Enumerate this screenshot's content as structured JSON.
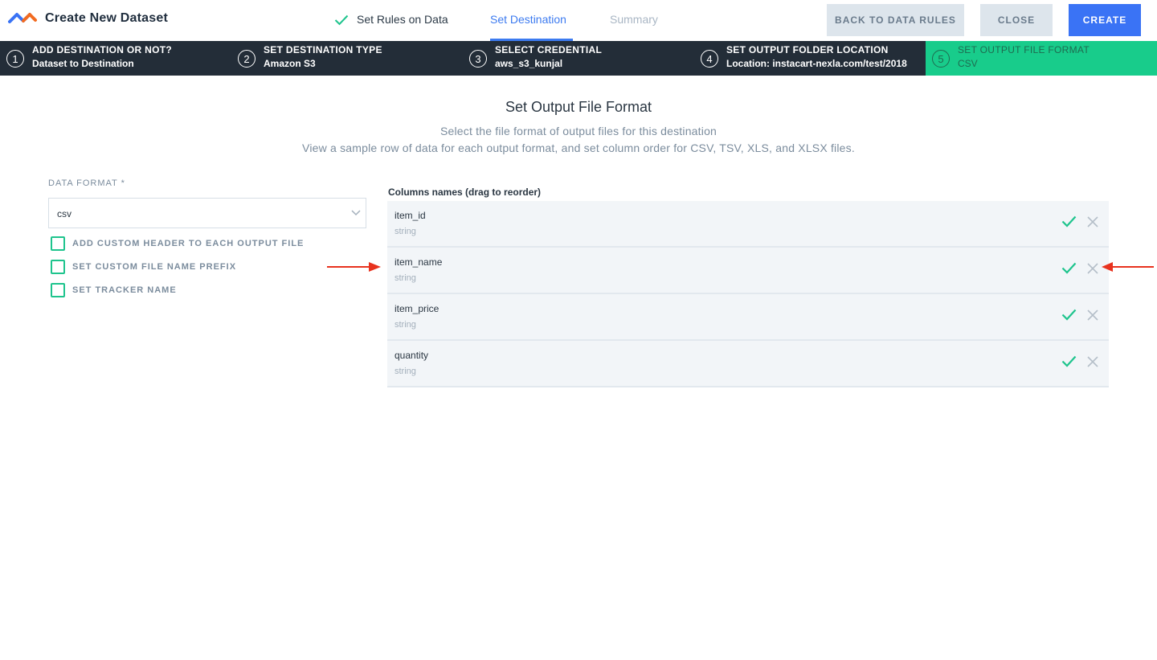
{
  "header": {
    "title": "Create New Dataset",
    "tabs": [
      {
        "label": "Set Rules on Data",
        "state": "done"
      },
      {
        "label": "Set Destination",
        "state": "active"
      },
      {
        "label": "Summary",
        "state": "pending"
      }
    ],
    "buttons": {
      "back": "BACK TO DATA RULES",
      "close": "CLOSE",
      "create": "CREATE"
    }
  },
  "stepper": [
    {
      "num": "1",
      "title": "ADD DESTINATION OR NOT?",
      "value": "Dataset to Destination"
    },
    {
      "num": "2",
      "title": "SET DESTINATION TYPE",
      "value": "Amazon S3"
    },
    {
      "num": "3",
      "title": "SELECT CREDENTIAL",
      "value": "aws_s3_kunjal"
    },
    {
      "num": "4",
      "title": "SET OUTPUT FOLDER LOCATION",
      "value": "Location: instacart-nexla.com/test/2018"
    },
    {
      "num": "5",
      "title": "SET OUTPUT FILE FORMAT",
      "value": "CSV",
      "active": true
    }
  ],
  "main": {
    "heading": "Set Output File Format",
    "subtitle1": "Select the file format of output files for this destination",
    "subtitle2": "View a sample row of data for each output format, and set column order for CSV, TSV, XLS, and XLSX files.",
    "data_format_label": "DATA FORMAT *",
    "data_format_value": "csv",
    "options": [
      "ADD CUSTOM HEADER TO EACH OUTPUT FILE",
      "SET CUSTOM FILE NAME PREFIX",
      "SET TRACKER NAME"
    ],
    "columns_label": "Columns names (drag to reorder)",
    "columns": [
      {
        "name": "item_id",
        "type": "string"
      },
      {
        "name": "item_name",
        "type": "string"
      },
      {
        "name": "item_price",
        "type": "string"
      },
      {
        "name": "quantity",
        "type": "string"
      }
    ]
  },
  "colors": {
    "accent_blue": "#3a73f5",
    "stepper_bg": "#232d38",
    "active_step": "#18cc8b",
    "check_green": "#1ec48d",
    "annotation_red": "#e8321e"
  }
}
